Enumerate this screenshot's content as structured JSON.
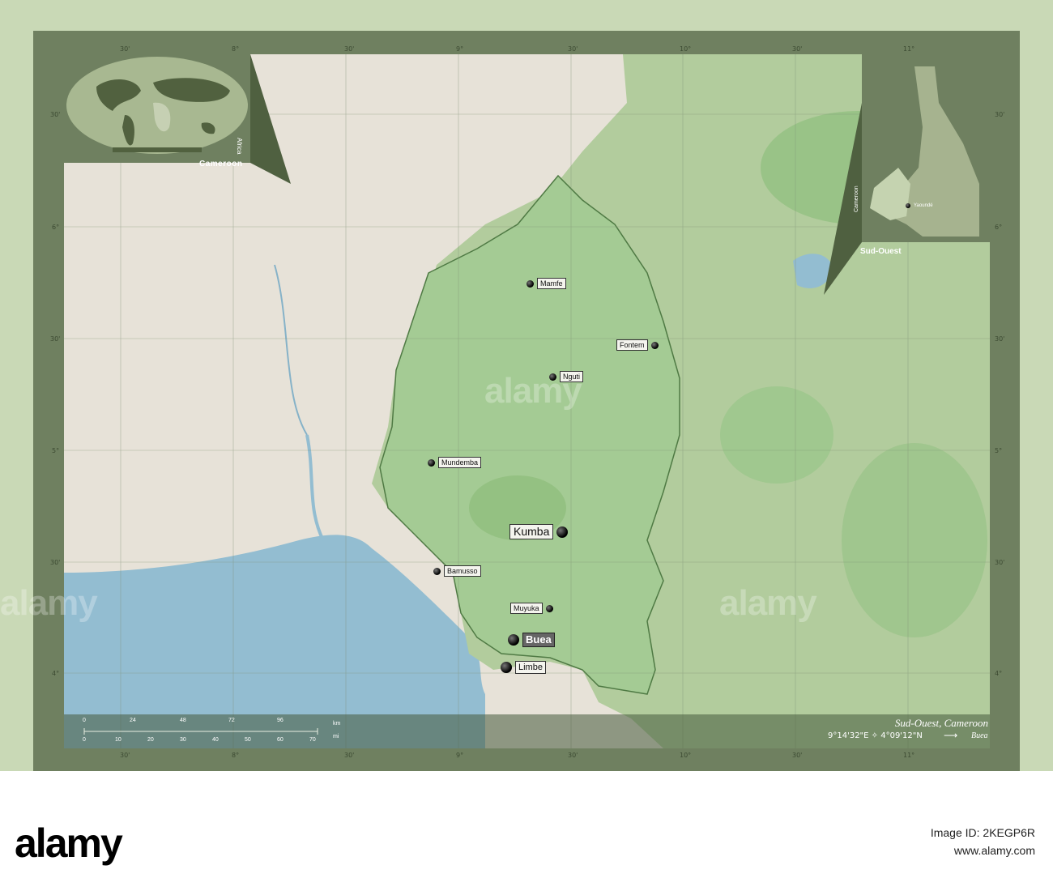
{
  "map": {
    "title": "Sud-Ouest, Cameroon",
    "coordinates": "9°14'32\"E ✧ 4°09'12\"N",
    "target_city": "Buea",
    "arrow": "⟶",
    "colors": {
      "frame": "#6f8060",
      "sea": "#92bcd0",
      "land_outside": "#e6e1d6",
      "region": "#a6c99a",
      "forest": "#8fbf7e",
      "border": "#4f7a44"
    }
  },
  "cities": [
    {
      "name": "Mamfe",
      "label": "Mamfe",
      "size": "small"
    },
    {
      "name": "Fontem",
      "label": "Fontem",
      "size": "small"
    },
    {
      "name": "Nguti",
      "label": "Nguti",
      "size": "small"
    },
    {
      "name": "Mundemba",
      "label": "Mundemba",
      "size": "small"
    },
    {
      "name": "Kumba",
      "label": "Kumba",
      "size": "large"
    },
    {
      "name": "Bamusso",
      "label": "Bamusso",
      "size": "small"
    },
    {
      "name": "Muyuka",
      "label": "Muyuka",
      "size": "small"
    },
    {
      "name": "Buea",
      "label": "Buea",
      "size": "capital"
    },
    {
      "name": "Limbe",
      "label": "Limbe",
      "size": "medium"
    }
  ],
  "ticks": {
    "top": [
      "30'",
      "8°",
      "30'",
      "9°",
      "30'",
      "10°",
      "30'",
      "11°"
    ],
    "bottom": [
      "30'",
      "8°",
      "30'",
      "9°",
      "30'",
      "10°",
      "30'",
      "11°"
    ],
    "left": [
      "30'",
      "6°",
      "30'",
      "5°",
      "30'",
      "4°"
    ],
    "right": [
      "30'",
      "6°",
      "30'",
      "5°",
      "30'",
      "4°"
    ]
  },
  "scalebar": {
    "km_ticks": [
      "0",
      "24",
      "48",
      "72",
      "96"
    ],
    "km_unit": "km",
    "mi_ticks": [
      "0",
      "10",
      "20",
      "30",
      "40",
      "50",
      "60",
      "70"
    ],
    "mi_unit": "mi"
  },
  "inset_world": {
    "label": "Cameroon",
    "continent": "Africa"
  },
  "inset_country": {
    "label": "Sud-Ouest",
    "country": "Cameroon",
    "capital": "Yaoundé"
  },
  "watermark": {
    "text": "alamy"
  },
  "footer": {
    "logo": "alamy",
    "image_id": "Image ID: 2KEGP6R",
    "site": "www.alamy.com"
  }
}
